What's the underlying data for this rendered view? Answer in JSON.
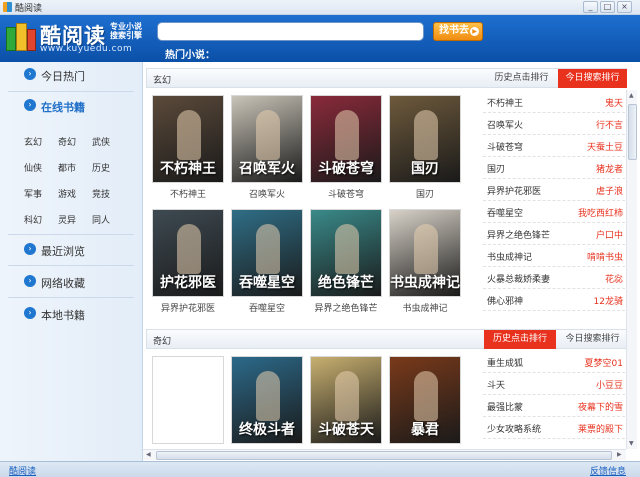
{
  "window": {
    "title": "酷阅读"
  },
  "header": {
    "logo_text": "酷阅读",
    "logo_tagline_1": "专业小说",
    "logo_tagline_2": "搜索引擎",
    "logo_url": "www.kuyuedu.com",
    "search_value": "",
    "search_button": "找书去",
    "hot_label": "热门小说："
  },
  "sidebar": {
    "today_hot": "今日热门",
    "online_books": "在线书籍",
    "genres": [
      "玄幻",
      "奇幻",
      "武侠",
      "仙侠",
      "都市",
      "历史",
      "军事",
      "游戏",
      "竞技",
      "科幻",
      "灵异",
      "同人"
    ],
    "recent": "最近浏览",
    "favorites": "网络收藏",
    "local": "本地书籍"
  },
  "section1": {
    "title": "玄幻",
    "tab_history": "历史点击排行",
    "tab_today": "今日搜索排行",
    "books": [
      {
        "title": "不朽神王",
        "cover_text": "不朽神王",
        "color": "#5b4a3a"
      },
      {
        "title": "召唤军火",
        "cover_text": "召唤军火",
        "color": "#c9c4b8"
      },
      {
        "title": "斗破苍穹",
        "cover_text": "斗破苍穹",
        "color": "#8a2a3a"
      },
      {
        "title": "国刃",
        "cover_text": "国刃",
        "color": "#6e5a3c"
      },
      {
        "title": "异界护花邪医",
        "cover_text": "护花邪医",
        "color": "#3e4a52"
      },
      {
        "title": "吞噬星空",
        "cover_text": "吞噬星空",
        "color": "#2f6e86"
      },
      {
        "title": "异界之绝色锋芒",
        "cover_text": "绝色锋芒",
        "color": "#3a8a8a"
      },
      {
        "title": "书虫成神记",
        "cover_text": "书虫成神记",
        "color": "#d8d2c8"
      }
    ],
    "ranking": [
      {
        "name": "不朽神王",
        "author": "鬼天"
      },
      {
        "name": "召唤军火",
        "author": "行不言"
      },
      {
        "name": "斗破苍穹",
        "author": "天蚕土豆"
      },
      {
        "name": "国刃",
        "author": "猪龙者"
      },
      {
        "name": "异界护花邪医",
        "author": "虐子浪"
      },
      {
        "name": "吞噬星空",
        "author": "我吃西红柿"
      },
      {
        "name": "异界之绝色锋芒",
        "author": "户口中"
      },
      {
        "name": "书虫成神记",
        "author": "啃啃书虫"
      },
      {
        "name": "火暴总裁娇柔妻",
        "author": "花惢"
      },
      {
        "name": "佛心邪神",
        "author": "12龙骑"
      }
    ]
  },
  "section2": {
    "title": "奇幻",
    "tab_history": "历史点击排行",
    "tab_today": "今日搜索排行",
    "books": [
      {
        "title": "",
        "cover_text": "",
        "color": "#ffffff"
      },
      {
        "title": "",
        "cover_text": "终极斗者",
        "color": "#2c6a8a"
      },
      {
        "title": "",
        "cover_text": "斗破苍天",
        "color": "#c8b070"
      },
      {
        "title": "",
        "cover_text": "暴君",
        "color": "#7a3a1a"
      }
    ],
    "ranking": [
      {
        "name": "重生成狐",
        "author": "夏梦空01"
      },
      {
        "name": "斗天",
        "author": "小豆豆"
      },
      {
        "name": "最强比蒙",
        "author": "夜幕下的雪"
      },
      {
        "name": "少女攻略系统",
        "author": "莱票的殿下"
      }
    ]
  },
  "status": {
    "left_link": "酷阅读",
    "right_link": "反馈信息"
  }
}
